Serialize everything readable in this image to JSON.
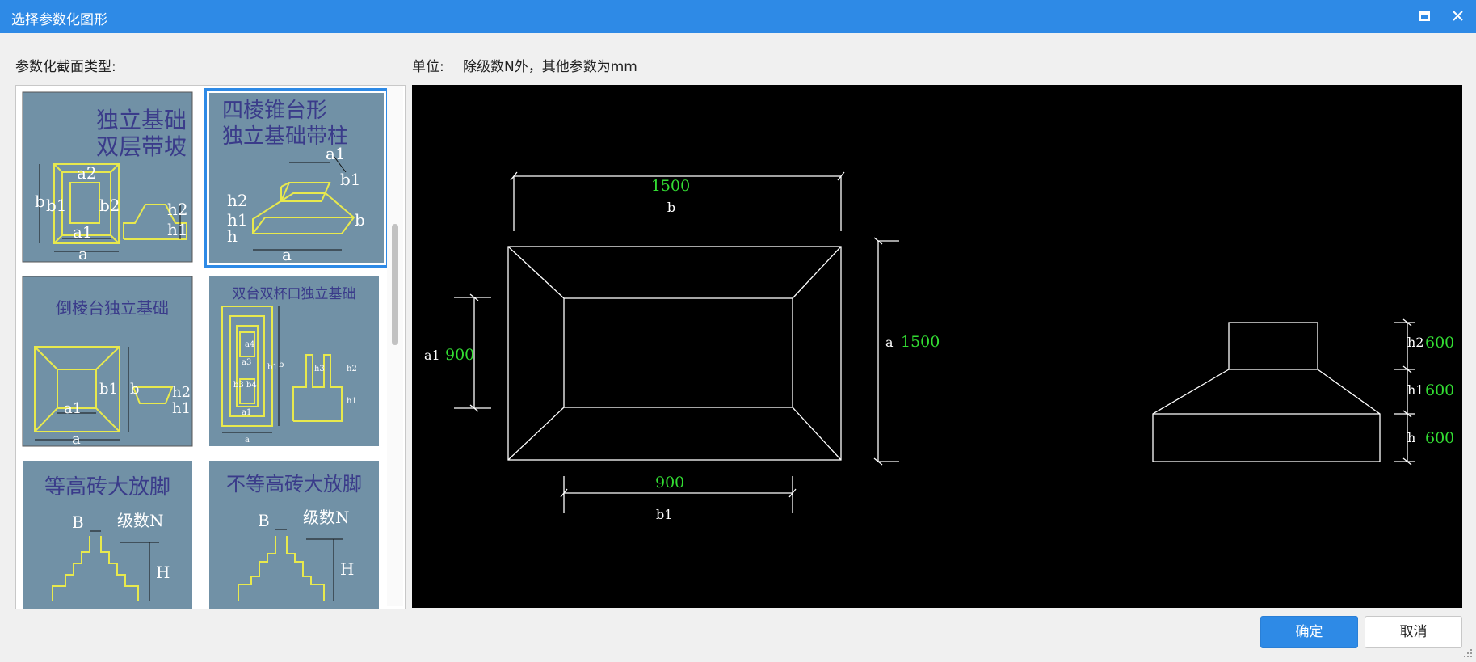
{
  "window": {
    "title": "选择参数化图形",
    "colors": {
      "titlebar": "#2e8ae6",
      "accent": "#2e8ae6",
      "thumb_bg": "#7191a6",
      "thumb_line": "#e8e94d",
      "dim_value": "#33dd33",
      "canvas_bg": "#000000"
    }
  },
  "labels": {
    "section_type": "参数化截面类型:",
    "unit_label": "单位:",
    "unit_text": "除级数N外，其他参数为mm"
  },
  "thumbnails": [
    {
      "title_line1": "独立基础",
      "title_line2": "双层带坡",
      "dims": {
        "a2": "a2",
        "b": "b",
        "b1": "b1",
        "b2": "b2",
        "a1": "a1",
        "a": "a",
        "h2": "h2",
        "h1": "h1"
      },
      "selected": false
    },
    {
      "title_line1": "四棱锥台形",
      "title_line2": "独立基础带柱",
      "dims": {
        "a1": "a1",
        "b1": "b1",
        "b": "b",
        "h2": "h2",
        "h1": "h1",
        "h": "h",
        "a": "a"
      },
      "selected": true
    },
    {
      "title": "倒棱台独立基础",
      "dims": {
        "b1": "b1",
        "b": "b",
        "a1": "a1",
        "a": "a",
        "h2": "h2",
        "h1": "h1"
      },
      "selected": false
    },
    {
      "title": "双台双杯口独立基础",
      "dims": {
        "a4": "a4",
        "a3": "a3",
        "b3": "b3",
        "b4": "b4",
        "a1": "a1",
        "a": "a",
        "b1": "b1",
        "b": "b",
        "h3": "h3",
        "h2": "h2",
        "h1": "h1"
      },
      "selected": false
    },
    {
      "title": "等高砖大放脚",
      "dims": {
        "B": "B",
        "N": "级数N",
        "H": "H"
      },
      "selected": false
    },
    {
      "title": "不等高砖大放脚",
      "dims": {
        "B": "B",
        "N": "级数N",
        "H": "H"
      },
      "selected": false
    }
  ],
  "drawing": {
    "plan": {
      "b_value": "1500",
      "b_label": "b",
      "a_value": "1500",
      "a_label": "a",
      "a1_value": "900",
      "a1_label": "a1",
      "b1_value": "900",
      "b1_label": "b1"
    },
    "section": {
      "h2_label": "h2",
      "h2_value": "600",
      "h1_label": "h1",
      "h1_value": "600",
      "h_label": "h",
      "h_value": "600"
    }
  },
  "buttons": {
    "ok": "确定",
    "cancel": "取消"
  },
  "icons": {
    "maximize": "maximize-icon",
    "close": "close-icon",
    "resize": "resize-grip-icon"
  }
}
